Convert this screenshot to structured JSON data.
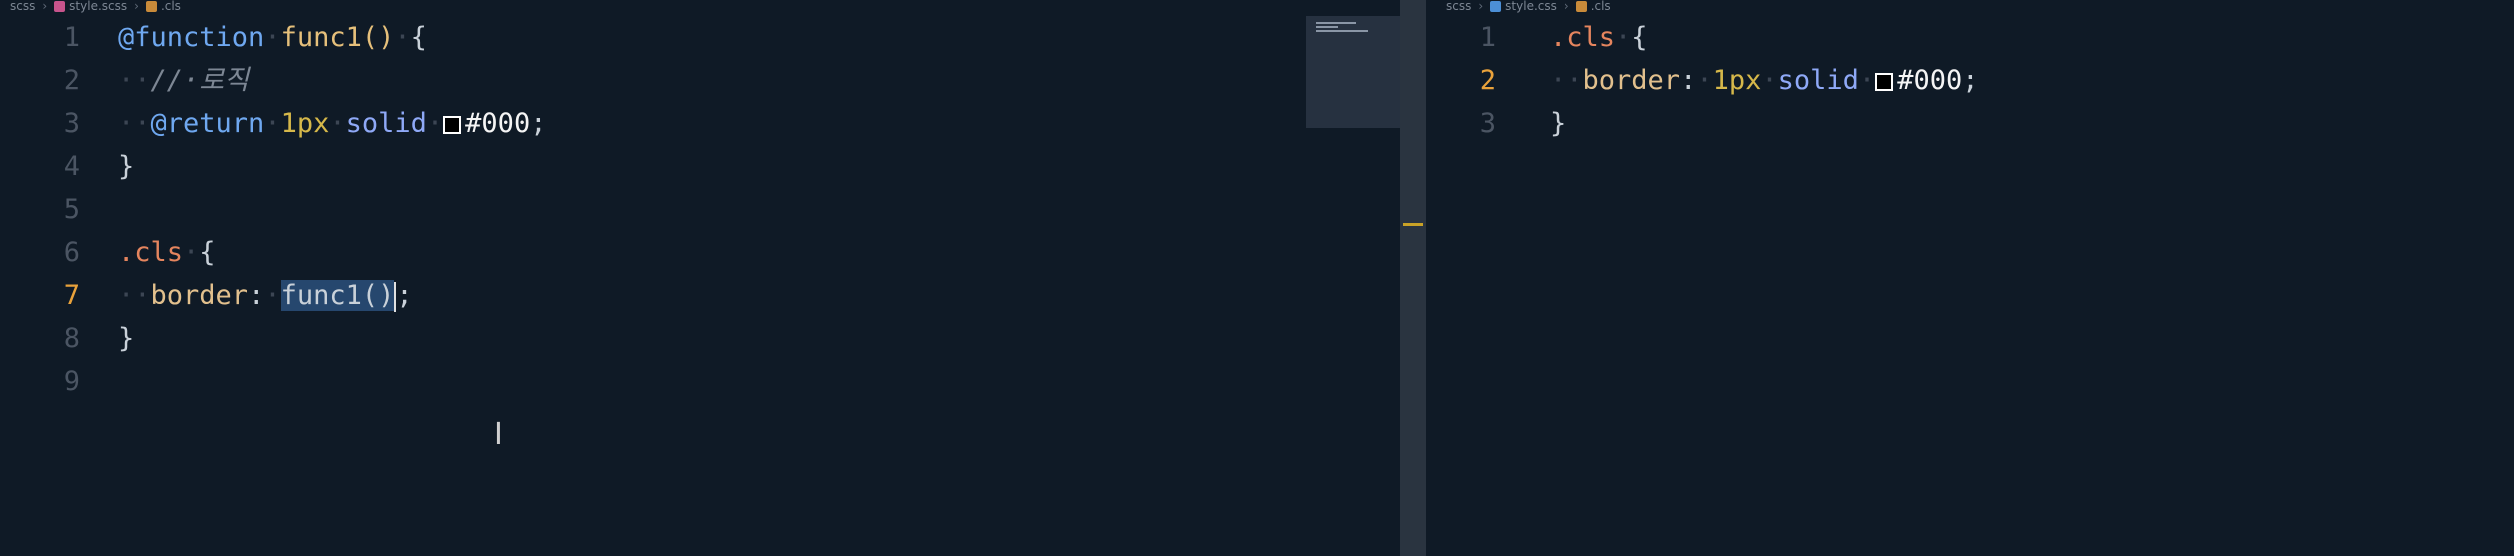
{
  "left_editor": {
    "breadcrumb": [
      "scss",
      "style.scss",
      ".cls"
    ],
    "lines": [
      {
        "num": "1",
        "parts": [
          [
            "kw-at",
            "@function"
          ],
          [
            "ws",
            "·"
          ],
          [
            "fn",
            "func1()"
          ],
          [
            "ws",
            "·"
          ],
          [
            "punc",
            "{"
          ]
        ]
      },
      {
        "num": "2",
        "parts": [
          [
            "ws",
            "··"
          ],
          [
            "cmt",
            "//·로직"
          ]
        ]
      },
      {
        "num": "3",
        "parts": [
          [
            "ws",
            "··"
          ],
          [
            "kw-at",
            "@return"
          ],
          [
            "ws",
            "·"
          ],
          [
            "num",
            "1px"
          ],
          [
            "ws",
            "·"
          ],
          [
            "val",
            "solid"
          ],
          [
            "ws",
            "·"
          ],
          [
            "swatch",
            ""
          ],
          [
            "hex",
            "#000"
          ],
          [
            "punc",
            ";"
          ]
        ]
      },
      {
        "num": "4",
        "parts": [
          [
            "punc",
            "}"
          ]
        ]
      },
      {
        "num": "5",
        "parts": []
      },
      {
        "num": "6",
        "parts": [
          [
            "sel",
            ".cls"
          ],
          [
            "ws",
            "·"
          ],
          [
            "punc",
            "{"
          ]
        ]
      },
      {
        "num": "7",
        "parts": [
          [
            "ws",
            "··"
          ],
          [
            "prop",
            "border"
          ],
          [
            "punc",
            ":"
          ],
          [
            "ws",
            "·"
          ],
          [
            "hl",
            "func1()"
          ],
          [
            "cursor",
            ""
          ],
          [
            "punc",
            ";"
          ]
        ]
      },
      {
        "num": "8",
        "parts": [
          [
            "punc",
            "}"
          ]
        ]
      },
      {
        "num": "9",
        "parts": []
      }
    ],
    "active_line": "7"
  },
  "right_editor": {
    "breadcrumb": [
      "scss",
      "style.css",
      ".cls"
    ],
    "lines": [
      {
        "num": "1",
        "parts": [
          [
            "sel",
            ".cls"
          ],
          [
            "ws",
            "·"
          ],
          [
            "punc",
            "{"
          ]
        ]
      },
      {
        "num": "2",
        "parts": [
          [
            "ws",
            "··"
          ],
          [
            "prop",
            "border"
          ],
          [
            "punc",
            ":"
          ],
          [
            "ws",
            "·"
          ],
          [
            "num",
            "1px"
          ],
          [
            "ws",
            "·"
          ],
          [
            "val",
            "solid"
          ],
          [
            "ws",
            "·"
          ],
          [
            "swatch",
            ""
          ],
          [
            "hex",
            "#000"
          ],
          [
            "punc",
            ";"
          ]
        ]
      },
      {
        "num": "3",
        "parts": [
          [
            "punc",
            "}"
          ]
        ]
      }
    ],
    "active_line": "2"
  },
  "swatch_color": "#000000",
  "accent_color": "#e9a23b"
}
